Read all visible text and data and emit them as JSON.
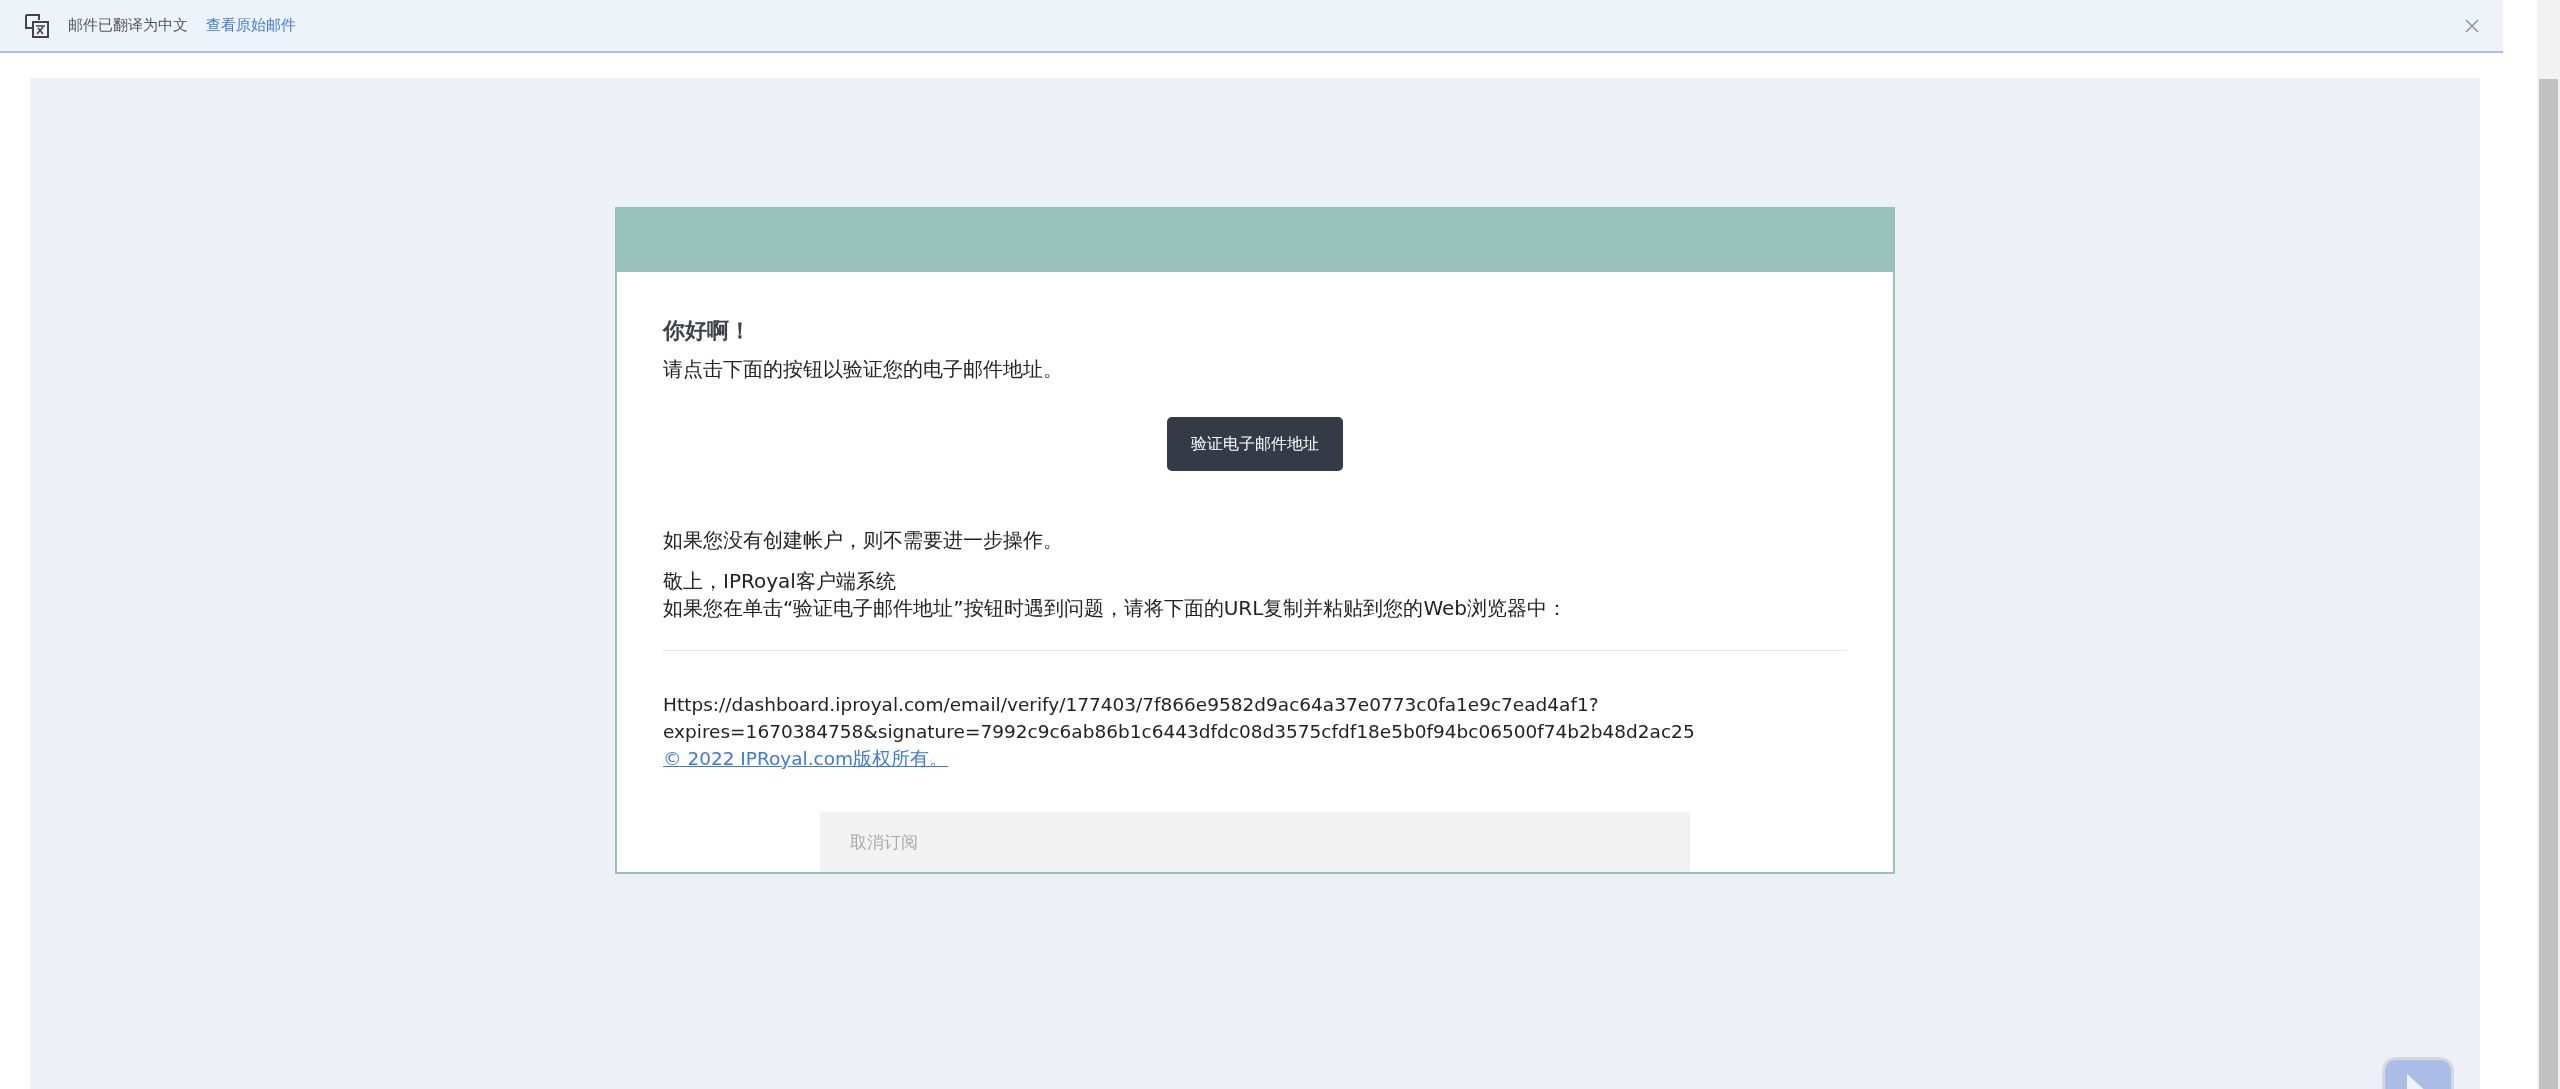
{
  "translation_bar": {
    "notice": "邮件已翻译为中文",
    "link": "查看原始邮件"
  },
  "email": {
    "greeting": "你好啊！",
    "intro": "请点击下面的按钮以验证您的电子邮件地址。",
    "button": "验证电子邮件地址",
    "no_account": "如果您没有创建帐户，则不需要进一步操作。",
    "signature": "敬上，IPRoyal客户端系统",
    "trouble": "如果您在单击“验证电子邮件地址”按钮时遇到问题，请将下面的URL复制并粘贴到您的Web浏览器中：",
    "url": "Https://dashboard.iproyal.com/email/verify/177403/7f866e9582d9ac64a37e0773c0fa1e9c7ead4af1?expires=1670384758&signature=7992c9c6ab86b1c6443dfdc08d3575cfdf18e5b0f94bc06500f74b2b48d2ac25",
    "copyright": "© 2022 IPRoyal.com版权所有。",
    "unsubscribe": "取消订阅"
  }
}
